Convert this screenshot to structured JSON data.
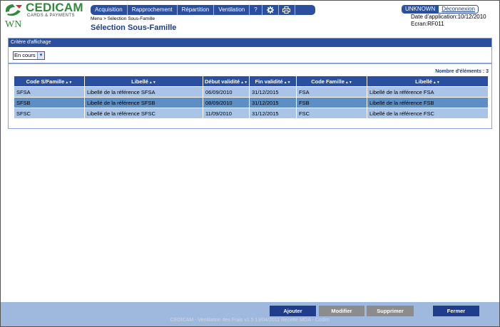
{
  "brand": {
    "name": "CEDICAM",
    "tagline": "CARDS & PAYMENTS",
    "user_initials": "WN"
  },
  "menu": {
    "items": [
      "Acquisition",
      "Rapprochement",
      "Répartition",
      "Ventilation",
      "?"
    ],
    "icons": [
      "gear-icon",
      "printer-icon"
    ]
  },
  "breadcrumb": "Menu > Sélection Sous-Famille",
  "page_title": "Sélection Sous-Famille",
  "user": {
    "name": "UNKNOWN",
    "logout_label": "Déconnexion",
    "app_date": "Date d'application:10/12/2010",
    "screen": "Ecran:RF011"
  },
  "filter": {
    "title": "Critère d'affichage",
    "select_value": "En cours"
  },
  "results": {
    "count_label": "Nombre d'éléments : 3",
    "columns": [
      "Code S/Famille",
      "Libellé",
      "Début validité",
      "Fin validité",
      "Code Famille",
      "Libellé"
    ],
    "rows": [
      [
        "SFSA",
        "Libellé de la référence SFSA",
        "06/09/2010",
        "31/12/2015",
        "FSA",
        "Libellé de la référence FSA"
      ],
      [
        "SFSB",
        "Libellé de la référence SFSB",
        "08/09/2010",
        "31/12/2015",
        "FSB",
        "Libellé de la référence FSB"
      ],
      [
        "SFSC",
        "Libellé de la référence SFSC",
        "11/09/2010",
        "31/12/2015",
        "FSC",
        "Libellé de la référence FSC"
      ]
    ]
  },
  "footer": {
    "buttons": {
      "add": "Ajouter",
      "modify": "Modifier",
      "delete": "Supprimer",
      "close": "Fermer"
    },
    "version_text": "CEDICAM - Ventilation des Frais v1.5 13/04/2011 Recette MOA - Codim"
  },
  "colors": {
    "primary": "#2a4f9e",
    "brand_green": "#2e8b3a",
    "row_light": "#a9c4e6",
    "row_selected": "#5e8ec6",
    "footer_bg": "#9fb8dd"
  }
}
